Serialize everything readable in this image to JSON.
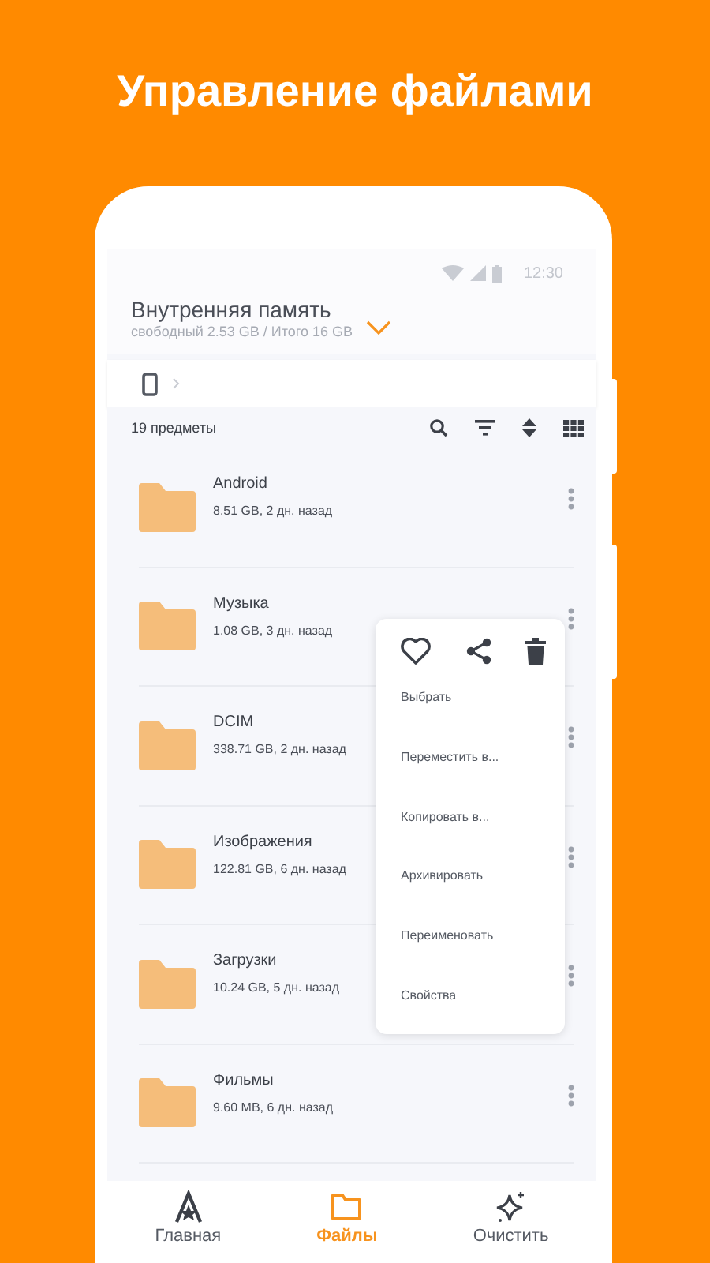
{
  "headline": "Управление файлами",
  "status_bar": {
    "time": "12:30"
  },
  "storage": {
    "title": "Внутренняя память",
    "subtitle": "свободный 2.53 GB / Итого 16 GB"
  },
  "toolbar": {
    "count": "19 предметы"
  },
  "folders": [
    {
      "name": "Android",
      "info": "8.51 GB, 2 дн. назад"
    },
    {
      "name": "Музыка",
      "info": "1.08 GB, 3 дн. назад"
    },
    {
      "name": "DCIM",
      "info": "338.71 GB, 2 дн. назад"
    },
    {
      "name": "Изображения",
      "info": "122.81 GB, 6 дн. назад"
    },
    {
      "name": "Загрузки",
      "info": "10.24 GB, 5 дн. назад"
    },
    {
      "name": "Фильмы",
      "info": "9.60 MB, 6 дн. назад"
    }
  ],
  "context_menu": {
    "items": [
      "Выбрать",
      "Переместить в...",
      "Копировать в...",
      "Архивировать",
      "Переименовать",
      "Свойства"
    ]
  },
  "bottom_nav": [
    {
      "kind": "home",
      "label": "Главная",
      "selected": false
    },
    {
      "kind": "files",
      "label": "Файлы",
      "selected": true
    },
    {
      "kind": "clean",
      "label": "Очистить",
      "selected": false
    }
  ]
}
